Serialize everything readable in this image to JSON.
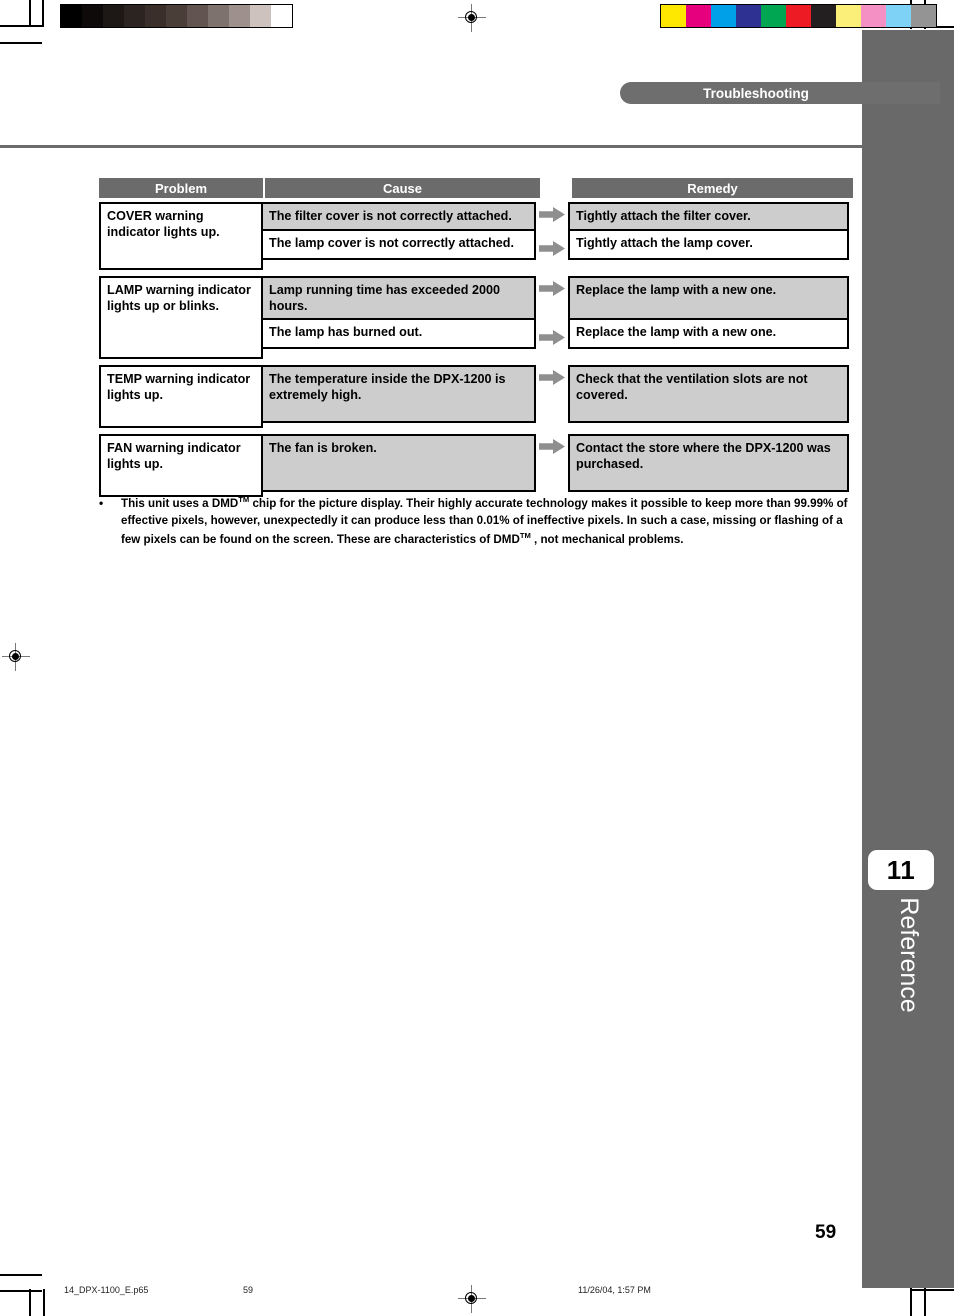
{
  "document": {
    "chapter_banner": "Troubleshooting",
    "page_number": "59",
    "side_tab_number": "11",
    "side_tab_label": "Reference"
  },
  "table": {
    "headers": {
      "problem": "Problem",
      "cause": "Cause",
      "remedy": "Remedy"
    },
    "arrow_icon": "right-arrow-icon",
    "groups": [
      {
        "problem": "COVER warning indicator lights up.",
        "rows": [
          {
            "cause": "The filter cover is not correctly attached.",
            "remedy": "Tightly attach the filter cover.",
            "shade": "gray"
          },
          {
            "cause": "The lamp cover is not correctly attached.",
            "remedy": "Tightly attach the lamp cover.",
            "shade": "white"
          }
        ]
      },
      {
        "problem": "LAMP warning indicator lights up or blinks.",
        "rows": [
          {
            "cause": "Lamp running time has exceeded 2000 hours.",
            "remedy": "Replace the lamp with a new one.",
            "shade": "gray"
          },
          {
            "cause": "The lamp has burned out.",
            "remedy": "Replace the lamp with a new one.",
            "shade": "white"
          }
        ]
      },
      {
        "problem": "TEMP warning indicator lights up.",
        "rows": [
          {
            "cause": "The temperature inside the DPX-1200 is extremely high.",
            "remedy": "Check that the ventilation slots are not covered.",
            "shade": "gray"
          }
        ]
      },
      {
        "problem": "FAN warning indicator lights up.",
        "rows": [
          {
            "cause": "The fan is broken.",
            "remedy": "Contact the store where the DPX-1200 was purchased.",
            "shade": "gray"
          }
        ]
      }
    ]
  },
  "note": {
    "bullet": "•",
    "part1": "This unit uses a DMD",
    "sup1": "TM",
    "part2": " chip for the picture display. Their highly accurate technology makes it possible to keep more than 99.99% of effective pixels, however, unexpectedly it can produce less than 0.01% of ineffective pixels. In such a case, missing or flashing of a few pixels can be found on the screen. These are characteristics of DMD",
    "sup2": "TM",
    "part3": " , not mechanical problems."
  },
  "footer": {
    "file_name": "14_DPX-1100_E.p65",
    "page": "59",
    "timestamp": "11/26/04, 1:57 PM"
  },
  "print_marks": {
    "gray_wedge": [
      "#000000",
      "#0d0a09",
      "#1d1715",
      "#2c2420",
      "#3a2f2b",
      "#4a3e39",
      "#625551",
      "#7e726e",
      "#9e918d",
      "#cdc2be",
      "#ffffff"
    ],
    "color_patches": [
      "#ffe800",
      "#e6007e",
      "#00a0e9",
      "#2e3192",
      "#00a651",
      "#ed1c24",
      "#231f20",
      "#fbef7a",
      "#f590c4",
      "#7ed2f5",
      "#949494"
    ]
  }
}
